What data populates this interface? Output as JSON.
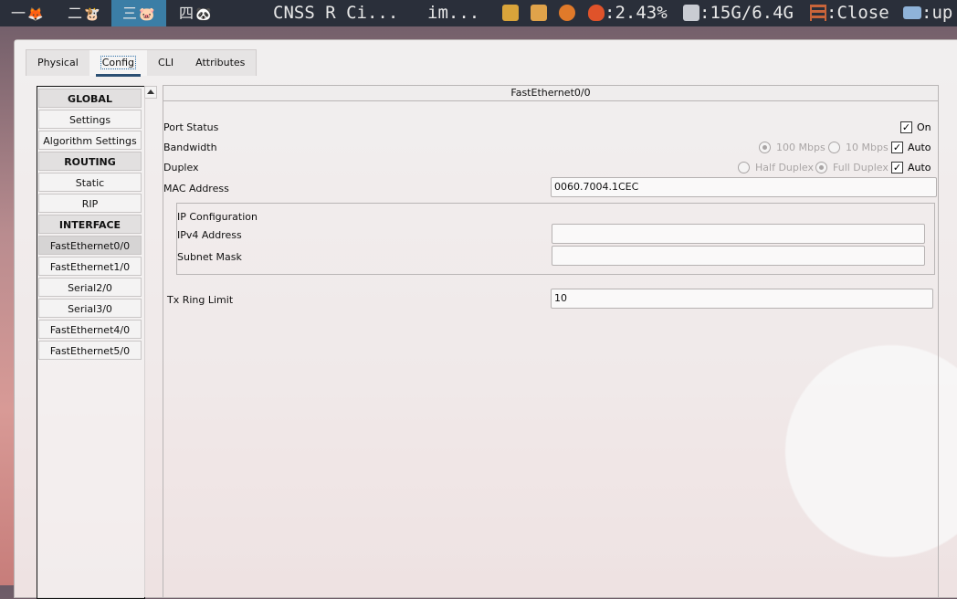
{
  "topbar": {
    "workspaces": [
      {
        "label": "一",
        "icon": "🦊"
      },
      {
        "label": "二",
        "icon": "🐮"
      },
      {
        "label": "三",
        "icon": "🐷"
      },
      {
        "label": "四",
        "icon": "🐼"
      }
    ],
    "window_title_1": "CNSS R Ci...",
    "window_title_2": "im...",
    "cpu": ":2.43%",
    "memory": ":15G/6.4G",
    "close_label": ":Close",
    "up_label": ":up",
    "colors": {
      "bar": "#2a2f3a",
      "active_workspace": "#3b7ea6"
    }
  },
  "tabs": [
    "Physical",
    "Config",
    "CLI",
    "Attributes"
  ],
  "active_tab": "Config",
  "nav": {
    "items": [
      {
        "label": "GLOBAL",
        "header": true
      },
      {
        "label": "Settings"
      },
      {
        "label": "Algorithm Settings"
      },
      {
        "label": "ROUTING",
        "header": true
      },
      {
        "label": "Static"
      },
      {
        "label": "RIP"
      },
      {
        "label": "INTERFACE",
        "header": true
      },
      {
        "label": "FastEthernet0/0",
        "selected": true
      },
      {
        "label": "FastEthernet1/0"
      },
      {
        "label": "Serial2/0"
      },
      {
        "label": "Serial3/0"
      },
      {
        "label": "FastEthernet4/0"
      },
      {
        "label": "FastEthernet5/0"
      }
    ]
  },
  "panel": {
    "title": "FastEthernet0/0",
    "port_status_label": "Port Status",
    "port_on_label": "On",
    "bandwidth_label": "Bandwidth",
    "bw_100": "100 Mbps",
    "bw_10": "10 Mbps",
    "bw_auto": "Auto",
    "duplex_label": "Duplex",
    "half_duplex": "Half Duplex",
    "full_duplex": "Full Duplex",
    "duplex_auto": "Auto",
    "mac_label": "MAC Address",
    "mac_value": "0060.7004.1CEC",
    "ip_config_label": "IP Configuration",
    "ipv4_label": "IPv4 Address",
    "ipv4_value": "",
    "subnet_label": "Subnet Mask",
    "subnet_value": "",
    "tx_label": "Tx Ring Limit",
    "tx_value": "10"
  }
}
